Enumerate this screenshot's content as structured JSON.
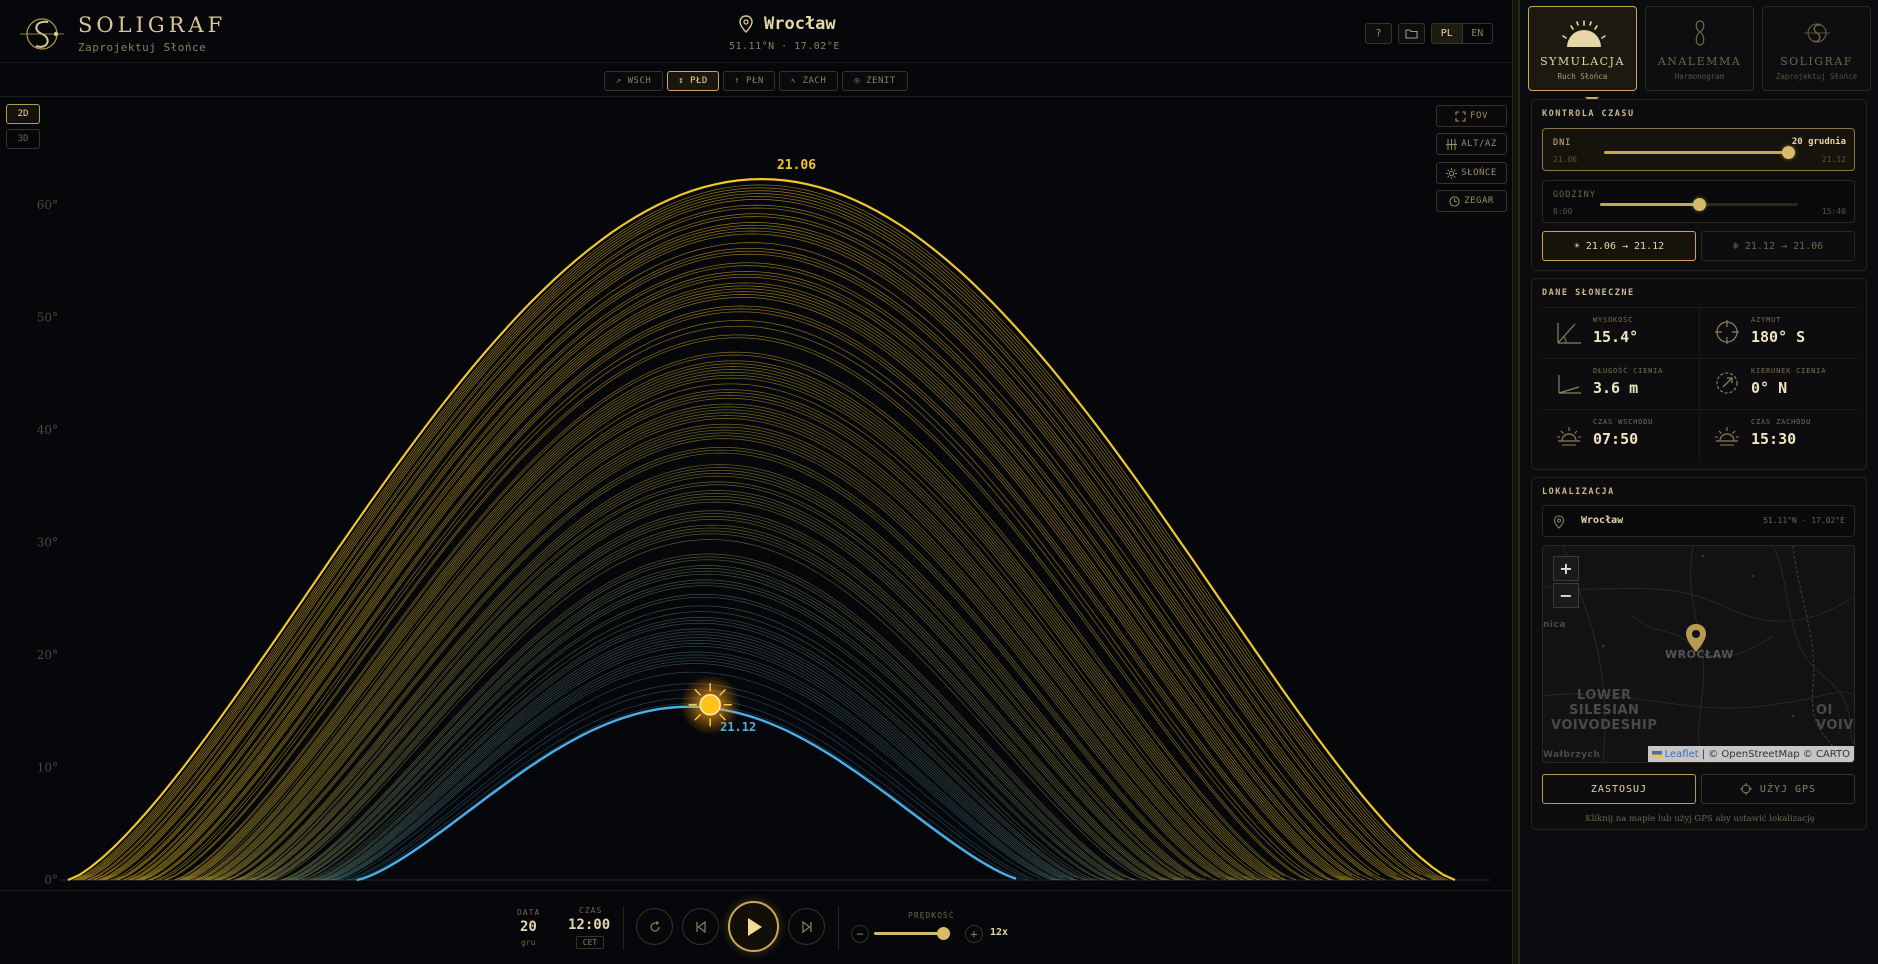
{
  "header": {
    "brand": "SOLIGRAF",
    "tagline": "Zaprojektuj Słońce",
    "location_name": "Wrocław",
    "location_coords": "51.11°N · 17.02°E",
    "help_label": "?",
    "lang_pl": "PL",
    "lang_en": "EN",
    "active_language": "PL"
  },
  "directions": [
    {
      "label": "↗ WSCH",
      "active": false
    },
    {
      "label": "↕ PŁD",
      "active": true
    },
    {
      "label": "↑ PŁN",
      "active": false
    },
    {
      "label": "↖ ZACH",
      "active": false
    },
    {
      "label": "◎ ZENIT",
      "active": false
    }
  ],
  "view_modes": {
    "mode_2d": "2D",
    "mode_3d": "3D",
    "active": "2D"
  },
  "overlays": {
    "fov": "FOV",
    "altaz": "ALT/AZ",
    "sun": "SŁOŃCE",
    "clock": "ZEGAR"
  },
  "chart_data": {
    "type": "line",
    "title": "",
    "xlabel": "",
    "ylabel": "",
    "x_range_hours": [
      4.5,
      20.5
    ],
    "ylim": [
      0,
      65
    ],
    "y_ticks": [
      0,
      10,
      20,
      30,
      40,
      50,
      60
    ],
    "y_tick_labels": [
      "0°",
      "10°",
      "20°",
      "30°",
      "40°",
      "50°",
      "60°"
    ],
    "annotations": [
      {
        "text": "21.06",
        "series": "21.06"
      },
      {
        "text": "21.12",
        "series": "21.12"
      }
    ],
    "series": [
      {
        "name": "21.06",
        "sunrise_h": 4.5,
        "sunset_h": 20.5,
        "peak_alt": 62.3,
        "color": "#f2c62a"
      },
      {
        "name": "21.12",
        "sunrise_h": 7.83,
        "sunset_h": 15.5,
        "peak_alt": 15.4,
        "color": "#4aaee8"
      }
    ],
    "intermediate_days": 183,
    "current_sun": {
      "hour": 12.0,
      "altitude": 15.4
    }
  },
  "bottom": {
    "date_label": "DATA",
    "date_day": "20",
    "date_month": "gru",
    "time_label": "CZAS",
    "time_value": "12:00",
    "time_zone": "CET",
    "speed_label": "PRĘDKOŚĆ",
    "speed_value": "12x",
    "speed_level": 0.9
  },
  "tabs": [
    {
      "title": "SYMULACJA",
      "sub": "Ruch Słońca",
      "active": true
    },
    {
      "title": "ANALEMMA",
      "sub": "Harmonogram",
      "active": false
    },
    {
      "title": "SOLIGRAF",
      "sub": "Zaprojektuj Słońce",
      "active": false
    }
  ],
  "time_control": {
    "title": "KONTROLA CZASU",
    "days_label": "DNI",
    "days_value": "20 grudnia",
    "days_min": "21.06",
    "days_max": "21.12",
    "days_level": 0.99,
    "hours_label": "GODZINY",
    "hours_min": "8:00",
    "hours_max": "15:40",
    "hours_level": 0.5,
    "seg_forward": "21.06 → 21.12",
    "seg_backward": "21.12 → 21.06"
  },
  "sun_data": {
    "title": "DANE SŁONECZNE",
    "items": [
      {
        "label": "WYSOKOŚĆ",
        "value": "15.4°",
        "icon": "altitude-icon"
      },
      {
        "label": "AZYMUT",
        "value": "180° S",
        "icon": "azimuth-icon"
      },
      {
        "label": "DŁUGOŚĆ CIENIA",
        "value": "3.6 m",
        "icon": "shadow-length-icon"
      },
      {
        "label": "KIERUNEK CIENIA",
        "value": "0° N",
        "icon": "shadow-direction-icon"
      },
      {
        "label": "CZAS WSCHODU",
        "value": "07:50",
        "icon": "sunrise-icon"
      },
      {
        "label": "CZAS ZACHODU",
        "value": "15:30",
        "icon": "sunset-icon"
      }
    ]
  },
  "location": {
    "title": "LOKALIZACJA",
    "city": "Wrocław",
    "coords": "51.11°N · 17.02°E",
    "map_labels": {
      "city": "WROCŁAW",
      "region": "LOWER\nSILESIAN\nVOIVODESHIP",
      "left_partial": "nica",
      "right_partial": "OI\nVOIVO",
      "bottom_left": "Wałbrzych"
    },
    "zoom_in": "+",
    "zoom_out": "−",
    "attribution_leaflet": "Leaflet",
    "attribution_rest": "| © OpenStreetMap © CARTO",
    "apply_label": "ZASTOSUJ",
    "gps_label": "UŻYJ GPS",
    "hint": "Kliknij na mapie lub użyj GPS aby ustawić lokalizację"
  }
}
